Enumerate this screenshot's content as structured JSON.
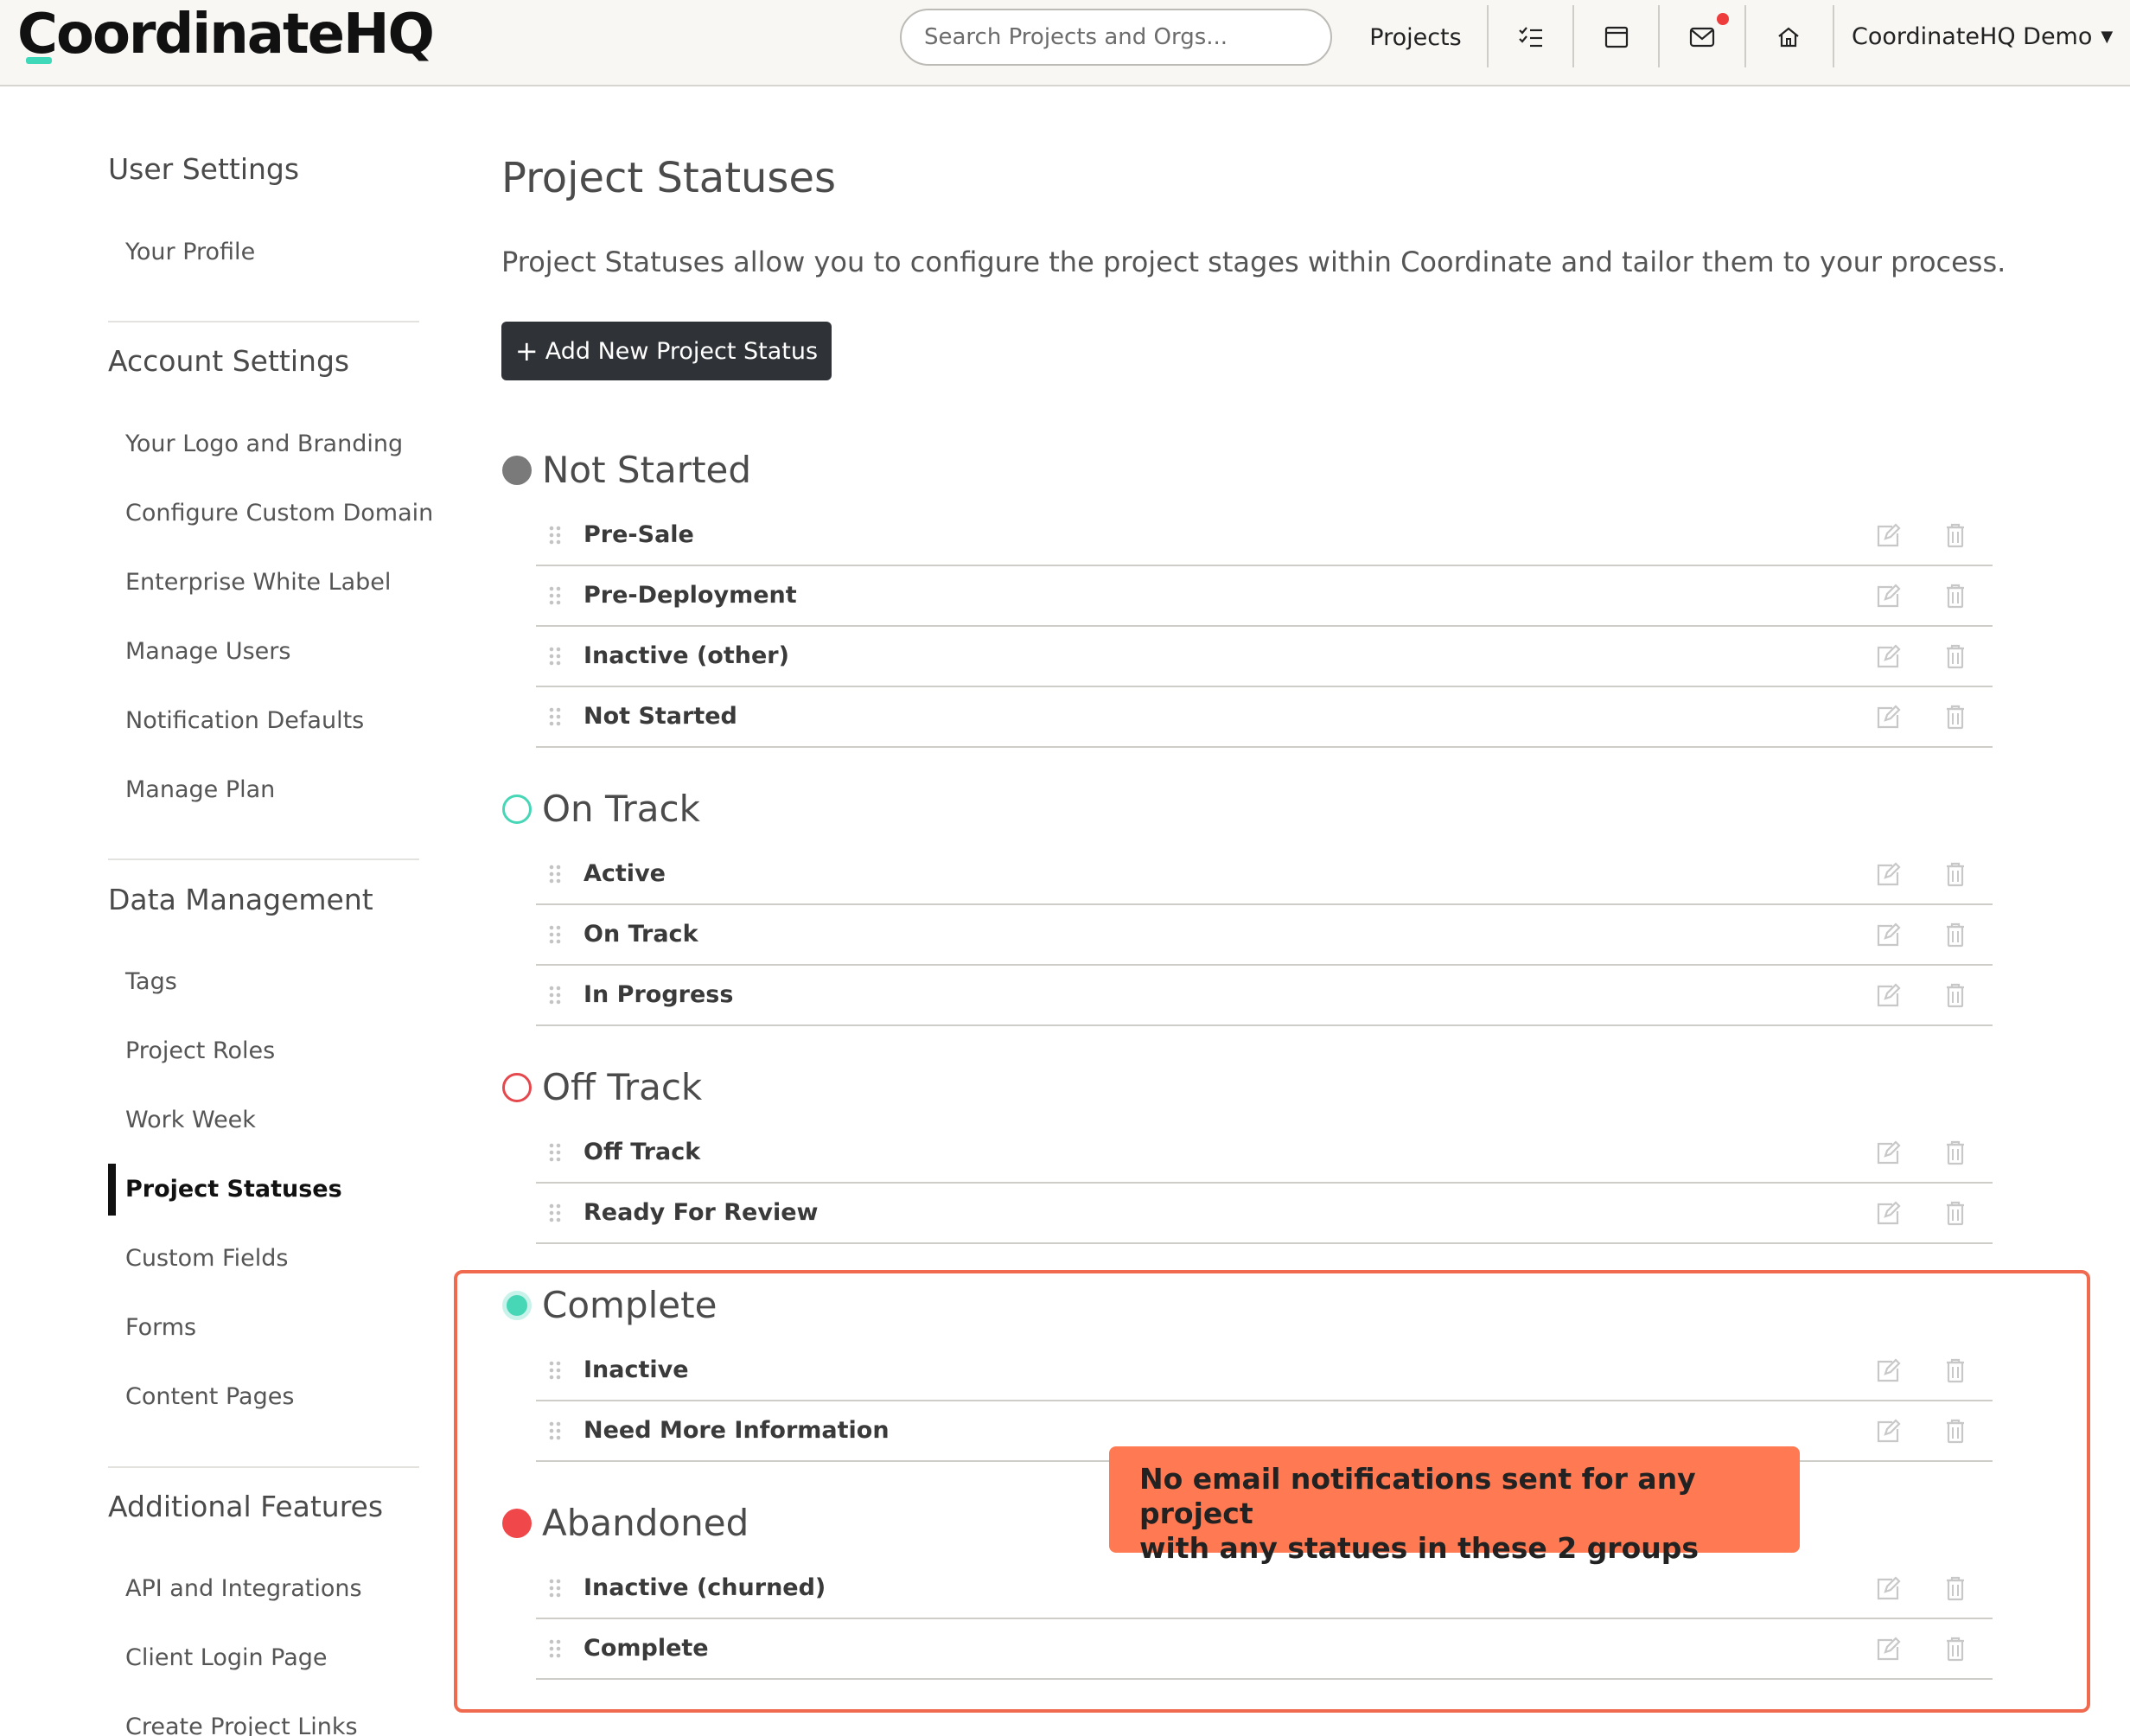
{
  "header": {
    "logo_text": "CoordinateHQ",
    "search_placeholder": "Search Projects and Orgs...",
    "nav_projects": "Projects",
    "icons": [
      "tasks-icon",
      "calendar-icon",
      "mail-icon",
      "home-icon"
    ],
    "account_name": "CoordinateHQ Demo",
    "notification_color": "#ee3b3b"
  },
  "sidebar": {
    "sections": [
      {
        "heading": "User Settings",
        "items": [
          "Your Profile"
        ]
      },
      {
        "heading": "Account Settings",
        "items": [
          "Your Logo and Branding",
          "Configure Custom Domain",
          "Enterprise White Label",
          "Manage Users",
          "Notification Defaults",
          "Manage Plan"
        ]
      },
      {
        "heading": "Data Management",
        "items": [
          "Tags",
          "Project Roles",
          "Work Week",
          "Project Statuses",
          "Custom Fields",
          "Forms",
          "Content Pages"
        ]
      },
      {
        "heading": "Additional Features",
        "items": [
          "API and Integrations",
          "Client Login Page",
          "Create Project Links"
        ]
      }
    ],
    "active_item": "Project Statuses"
  },
  "main": {
    "title": "Project Statuses",
    "description": "Project Statuses allow you to configure the project stages within Coordinate and tailor them to your process.",
    "add_button_plus": "+",
    "add_button_label": "Add New Project Status",
    "groups": [
      {
        "title": "Not Started",
        "dot_style": "filled",
        "color": "#7a7a7a",
        "statuses": [
          "Pre-Sale",
          "Pre-Deployment",
          "Inactive (other)",
          "Not Started"
        ]
      },
      {
        "title": "On Track",
        "dot_style": "outline",
        "color": "#47d6b6",
        "statuses": [
          "Active",
          "On Track",
          "In Progress"
        ]
      },
      {
        "title": "Off Track",
        "dot_style": "outline",
        "color": "#e5484d",
        "statuses": [
          "Off Track",
          "Ready For Review"
        ]
      },
      {
        "title": "Complete",
        "dot_style": "filled-ring",
        "color": "#47d6b6",
        "statuses": [
          "Inactive",
          "Need More Information"
        ]
      },
      {
        "title": "Abandoned",
        "dot_style": "filled",
        "color": "#f0484a",
        "statuses": [
          "Inactive (churned)",
          "Complete"
        ]
      }
    ]
  },
  "annotation": {
    "line1": "No email notifications sent for any project",
    "line2": "with any statues in these 2 groups",
    "box_color": "#ef6a4f",
    "callout_color": "#ff7a52"
  }
}
